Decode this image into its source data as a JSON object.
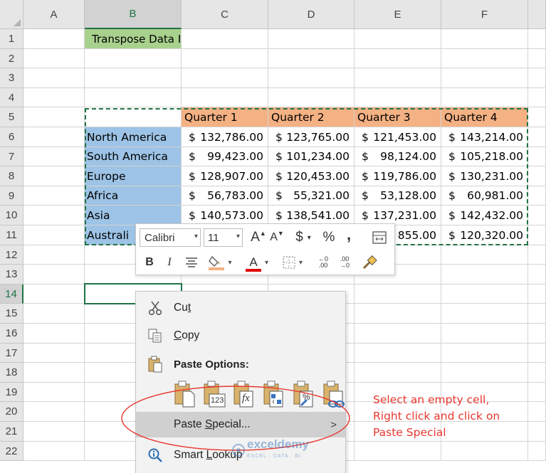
{
  "sheet": {
    "columns": [
      "A",
      "B",
      "C",
      "D",
      "E",
      "F"
    ],
    "rows": [
      "1",
      "2",
      "3",
      "4",
      "5",
      "6",
      "7",
      "8",
      "9",
      "10",
      "11",
      "12",
      "13",
      "14",
      "15",
      "16",
      "17",
      "18",
      "19",
      "20",
      "21",
      "22"
    ],
    "title": "Transpose Data In Excel",
    "headers": [
      "Quarter 1",
      "Quarter 2",
      "Quarter 3",
      "Quarter 4"
    ],
    "regions": [
      "North America",
      "South America",
      "Europe",
      "Africa",
      "Asia",
      "Australia"
    ],
    "region_visible_text_row11": "Australi",
    "currency_symbol": "$",
    "values": [
      [
        "132,786.00",
        "123,765.00",
        "121,453.00",
        "143,214.00"
      ],
      [
        "99,423.00",
        "101,234.00",
        "98,124.00",
        "105,218.00"
      ],
      [
        "128,907.00",
        "120,453.00",
        "119,786.00",
        "130,231.00"
      ],
      [
        "56,783.00",
        "55,321.00",
        "53,128.00",
        "60,981.00"
      ],
      [
        "140,573.00",
        "138,541.00",
        "137,231.00",
        "142,432.00"
      ],
      [
        "",
        "",
        "855.00",
        "120,320.00"
      ]
    ],
    "selected_column": "B",
    "selected_row": "14",
    "colors": {
      "title_fill": "#a9d18e",
      "header_fill": "#f4b183",
      "region_fill": "#9dc3e6",
      "selection": "#217346"
    }
  },
  "mini_toolbar": {
    "font_name": "Calibri",
    "font_size": "11",
    "increase_font": "A",
    "decrease_font": "A",
    "currency": "$",
    "percent": "%",
    "comma": ",",
    "bold": "B",
    "italic": "I",
    "font_color_letter": "A",
    "dec_more": ".00",
    "dec_less": ".00"
  },
  "context_menu": {
    "cut": {
      "label_pre": "Cu",
      "label_ul": "t",
      "label_post": ""
    },
    "copy": {
      "label_pre": "",
      "label_ul": "C",
      "label_post": "opy"
    },
    "paste_options_label": "Paste Options:",
    "paste_icons": [
      "paste-icon",
      "paste-values-icon",
      "paste-formulas-icon",
      "paste-transpose-icon",
      "paste-formatting-icon",
      "paste-link-icon"
    ],
    "paste_values_text": "123",
    "paste_formulas_text": "fx",
    "paste_formatting_text": "%",
    "paste_special": {
      "label_pre": "Paste ",
      "label_ul": "S",
      "label_post": "pecial..."
    },
    "submenu_arrow": ">",
    "smart_lookup": {
      "label_pre": "Smart ",
      "label_ul": "L",
      "label_post": "ookup"
    }
  },
  "annotation": {
    "lines": [
      "Select an empty cell,",
      "Right click and click on",
      "Paste Special"
    ],
    "color": "#e8372e"
  },
  "watermark": {
    "name": "exceldemy",
    "tagline": "EXCEL · DATA · BI"
  }
}
